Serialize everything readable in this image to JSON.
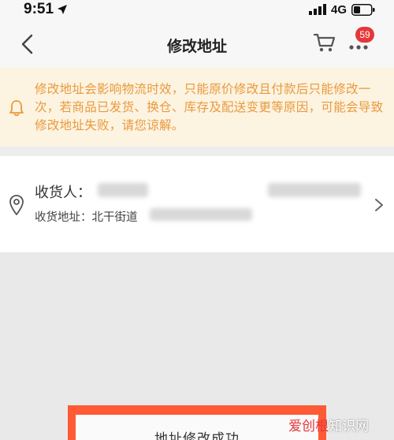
{
  "status_bar": {
    "time": "9:51",
    "network": "4G"
  },
  "nav": {
    "title": "修改地址",
    "cart_badge_count": "59"
  },
  "notice": {
    "text": "修改地址会影响物流时效，只能原价修改且付款后只能修改一次，若商品已发货、换仓、库存及配送变更等原因，可能会导致修改地址失败，请您谅解。"
  },
  "address": {
    "receiver_label": "收货人：",
    "address_label": "收货地址：北干街道"
  },
  "toast": {
    "message": "地址修改成功"
  },
  "watermark": {
    "accent": "爱创根",
    "text": "知识网"
  },
  "colors": {
    "notice_bg": "#fdf3e1",
    "notice_text": "#e89a3c",
    "badge": "#e5373a",
    "toast_frame": "#ff5a36"
  }
}
